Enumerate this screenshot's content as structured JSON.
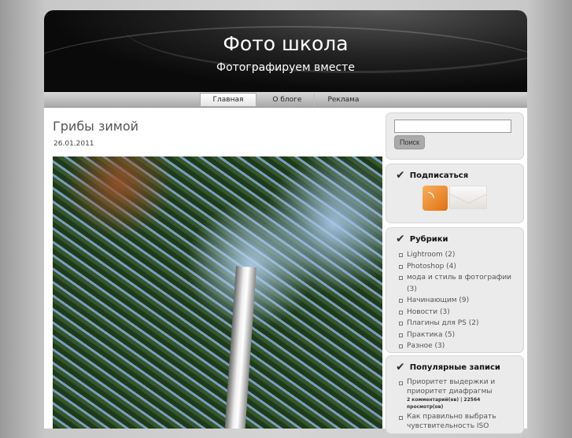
{
  "header": {
    "title": "Фото школа",
    "description": "Фотографируем вместе"
  },
  "nav": {
    "items": [
      "Главная",
      "О блоге",
      "Реклама"
    ]
  },
  "post": {
    "title": "Грибы зимой",
    "date": "26.01.2011"
  },
  "sidebar": {
    "search": {
      "button": "Поиск",
      "value": ""
    },
    "subscribe": {
      "title": "Подписаться"
    },
    "categories": {
      "title": "Рубрики",
      "items": [
        "Lightroom (2)",
        "Photoshop (4)",
        "мода и стиль в фотографии (3)",
        "Начинающим (9)",
        "Новости (3)",
        "Плагины для PS (2)",
        "Практика (5)",
        "Разное (3)"
      ]
    },
    "popular": {
      "title": "Популярные записи",
      "items": [
        {
          "title": "Приоритет выдержки и приоритет диафрагмы",
          "meta": "2 комментарий(ев) | 22564 просмотр(ов)"
        },
        {
          "title": "Как правильно выбрать чувствительность ISO"
        }
      ]
    }
  }
}
